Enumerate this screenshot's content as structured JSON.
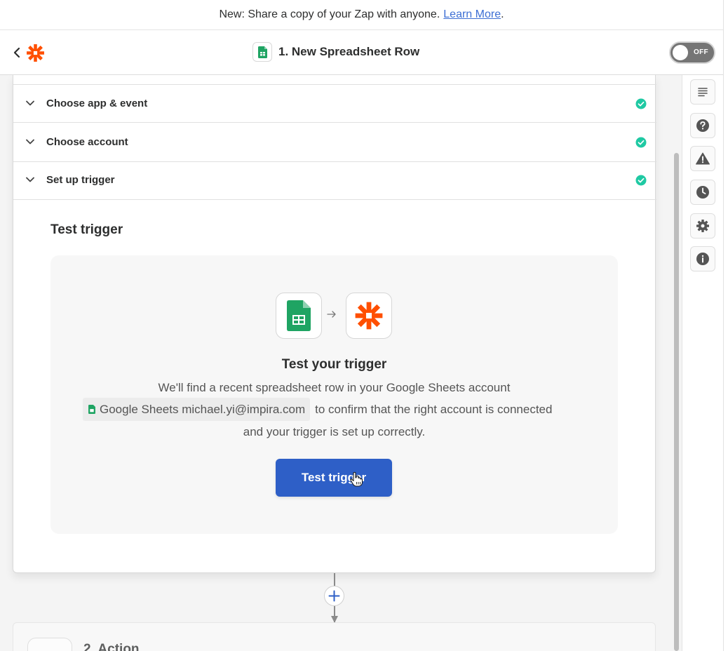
{
  "banner": {
    "text": "New: Share a copy of your Zap with anyone.",
    "link": "Learn More",
    "suffix": "."
  },
  "header": {
    "title": "1. New Spreadsheet Row",
    "toggle_label": "OFF"
  },
  "steps": [
    {
      "label": "Choose app & event",
      "status": "complete"
    },
    {
      "label": "Choose account",
      "status": "complete"
    },
    {
      "label": "Set up trigger",
      "status": "complete"
    }
  ],
  "test_section": {
    "title": "Test trigger",
    "heading": "Test your trigger",
    "line1": "We'll find a recent spreadsheet row in your Google Sheets account",
    "account_chip": "Google Sheets michael.yi@impira.com",
    "line2_suffix": "to confirm that the right account is connected",
    "line3": "and your trigger is set up correctly.",
    "button_label": "Test trigger"
  },
  "next_step": {
    "label": "2. Action"
  },
  "sidebar_icons": [
    "details-icon",
    "help-icon",
    "warning-icon",
    "history-icon",
    "settings-icon",
    "info-icon"
  ],
  "colors": {
    "accent": "#2e5fc7",
    "success": "#1fc9a3",
    "zapier_orange": "#ff4f00",
    "sheets_green": "#1fa463",
    "link": "#3d6fd4"
  }
}
